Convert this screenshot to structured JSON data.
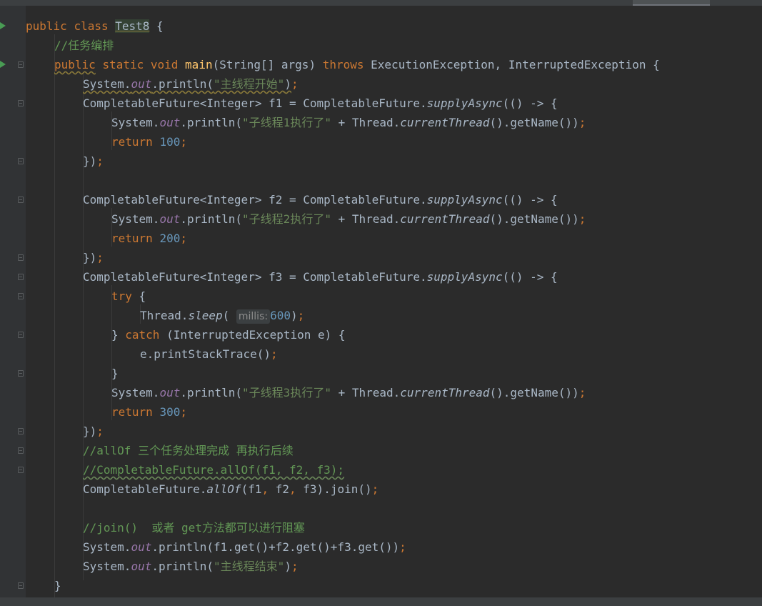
{
  "editor": {
    "language": "java",
    "class_keyword_public": "public",
    "class_keyword_class": "class",
    "class_name": "Test8",
    "comment_task": "//任务编排",
    "main_modifiers": "public",
    "main_static": "static",
    "main_void": "void",
    "main_name": "main",
    "main_params": "(String[] args)",
    "main_throws": "throws",
    "main_exceptions": "ExecutionException, InterruptedException {",
    "main_start_msg": "\"主线程开始\"",
    "f1_msg": "\"子线程1执行了\"",
    "f1_return": "100",
    "f2_msg": "\"子线程2执行了\"",
    "f2_return": "200",
    "sleep_hint": "millis:",
    "sleep_value": "600",
    "f3_msg": "\"子线程3执行了\"",
    "f3_return": "300",
    "comment_allof": "//allOf 三个任务处理完成 再执行后续",
    "comment_allof_code": "//CompletableFuture.allOf(f1, f2, f3);",
    "comment_join": "//join()  或者 get方法都可以进行阻塞",
    "main_end_msg": "\"主线程结束\""
  },
  "colors": {
    "background": "#2b2b2b",
    "gutter": "#313335",
    "keyword": "#cc7832",
    "string": "#6a8759",
    "number": "#6897bb",
    "comment": "#629755",
    "method_decl": "#ffc66d",
    "static_field": "#9876aa",
    "default_text": "#a9b7c6",
    "run_icon": "#499c54"
  }
}
